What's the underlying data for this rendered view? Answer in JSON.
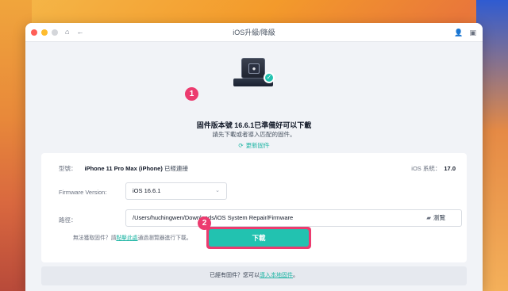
{
  "window": {
    "title": "iOS升級/降級"
  },
  "hero": {
    "title": "固件版本號 16.6.1已準備好可以下載",
    "subtitle": "請先下載或者導入匹配的固件。",
    "update_link": "更新固件",
    "step1": "1",
    "step2": "2"
  },
  "device": {
    "model_label": "型號：",
    "model_value": "iPhone 11 Pro Max (iPhone)",
    "connected_text": " 已經連接",
    "ios_label": "iOS 系統：",
    "ios_value": "17.0"
  },
  "firmware": {
    "label": "Firmware Version:",
    "selected": "iOS 16.6.1"
  },
  "path": {
    "label": "路徑：",
    "value": "/Users/huchingwen/Downloads/iOS System Repair/Firmware",
    "browse_label": "瀏覽"
  },
  "help": {
    "prefix": "無法獲取固件？請",
    "link": "點擊此處",
    "suffix": "通過瀏覽器進行下載。"
  },
  "actions": {
    "download_label": "下載"
  },
  "footer": {
    "prefix": "已經有固件？您可以",
    "link": "導入本地固件",
    "suffix": "。"
  },
  "colors": {
    "accent": "#22c2b0",
    "highlight": "#ec3b6f"
  },
  "icons": {
    "home": "home-icon",
    "back": "back-arrow-icon",
    "user": "user-icon",
    "feedback": "feedback-icon",
    "refresh": "refresh-icon",
    "folder": "folder-icon",
    "chevron": "chevron-down-icon"
  }
}
